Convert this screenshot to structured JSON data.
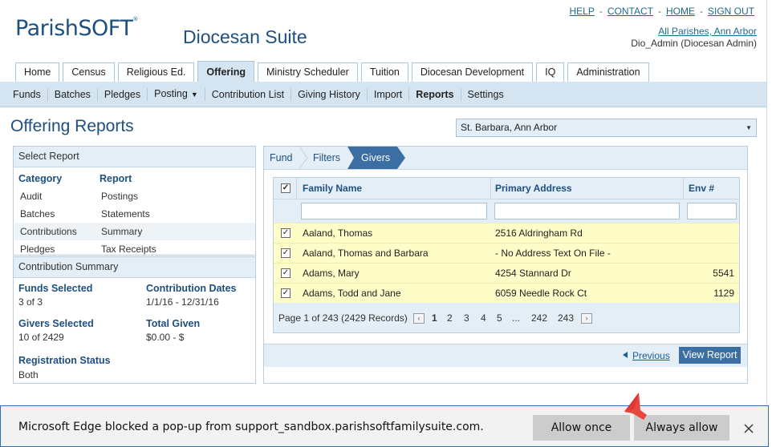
{
  "header": {
    "logo_text_main": "Parish",
    "logo_text_soft": "SOFT",
    "logo_mark": "®",
    "suite_title": "Diocesan Suite",
    "links": [
      "HELP",
      "CONTACT",
      "HOME",
      "SIGN OUT"
    ],
    "separator": "-",
    "parish_link": "All Parishes, Ann Arbor",
    "user_label": "Dio_Admin (Diocesan Admin)"
  },
  "main_tabs": [
    "Home",
    "Census",
    "Religious Ed.",
    "Offering",
    "Ministry Scheduler",
    "Tuition",
    "Diocesan Development",
    "IQ",
    "Administration"
  ],
  "main_tab_active": "Offering",
  "sub_tabs": [
    "Funds",
    "Batches",
    "Pledges",
    "Posting",
    "Contribution List",
    "Giving History",
    "Import",
    "Reports",
    "Settings"
  ],
  "sub_tab_caret": "▼",
  "page": {
    "title": "Offering Reports",
    "parish_select": "St. Barbara, Ann Arbor",
    "parish_select_arrow": "▼"
  },
  "select_report": {
    "heading": "Select Report",
    "category_header": "Category",
    "report_header": "Report",
    "rows": [
      {
        "category": "Audit",
        "report": "Postings"
      },
      {
        "category": "Batches",
        "report": "Statements"
      },
      {
        "category": "Contributions",
        "report": "Summary"
      },
      {
        "category": "Pledges",
        "report": "Tax Receipts"
      }
    ]
  },
  "summary": {
    "heading": "Contribution Summary",
    "funds_label": "Funds Selected",
    "funds_value": "3 of 3",
    "dates_label": "Contribution Dates",
    "dates_value": "1/1/16 - 12/31/16",
    "givers_label": "Givers Selected",
    "givers_value": "10 of 2429",
    "total_label": "Total Given",
    "total_value": "$0.00 - $",
    "reg_label": "Registration Status",
    "reg_value": "Both"
  },
  "wizard": {
    "steps": [
      "Fund",
      "Filters",
      "Givers"
    ]
  },
  "grid": {
    "columns": [
      "Family Name",
      "Primary Address",
      "Env #"
    ],
    "rows": [
      {
        "name": "Aaland, Thomas",
        "address": "2516 Aldringham Rd",
        "env": ""
      },
      {
        "name": "Aaland, Thomas and Barbara",
        "address": "- No Address Text On File -",
        "env": ""
      },
      {
        "name": "Adams, Mary",
        "address": "4254 Stannard Dr",
        "env": "5541"
      },
      {
        "name": "Adams, Todd and Jane",
        "address": "6059 Needle Rock Ct",
        "env": "1129"
      }
    ],
    "check": "✓",
    "pager_text": "Page 1 of 243 (2429 Records)",
    "pages": [
      "1",
      "2",
      "3",
      "4",
      "5",
      "...",
      "242",
      "243"
    ],
    "prev_glyph": "‹",
    "next_glyph": "›"
  },
  "footer": {
    "previous": "Previous",
    "view_report": "View Report"
  },
  "edge": {
    "message": "Microsoft Edge blocked a pop-up from support_sandbox.parishsoftfamilysuite.com.",
    "allow_once": "Allow once",
    "always_allow": "Always allow"
  },
  "colors": {
    "brand_blue": "#1d4f80",
    "tab_active_bg": "#d4e4f1",
    "selected_row_bg": "#fffdc7",
    "button_bg": "#3b6fa3",
    "annotation_arrow": "#e8473f"
  }
}
